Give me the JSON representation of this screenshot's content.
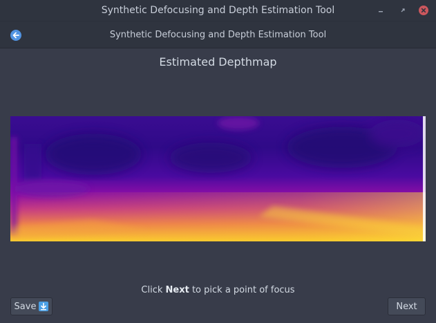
{
  "window": {
    "title": "Synthetic Defocusing and Depth Estimation Tool"
  },
  "header": {
    "subtitle": "Synthetic Defocusing and Depth Estimation Tool",
    "back_icon": "back-arrow-icon"
  },
  "main": {
    "heading": "Estimated Depthmap",
    "instruction_prefix": "Click ",
    "instruction_bold": "Next",
    "instruction_suffix": " to pick a point of focus"
  },
  "footer": {
    "save_label": "Save",
    "save_icon": "download-icon",
    "next_label": "Next"
  },
  "colors": {
    "accent": "#5294e2",
    "close": "#cc575d",
    "depth_far": "#2d0a82",
    "depth_mid": "#8a0ea6",
    "depth_near": "#f8c92b"
  }
}
